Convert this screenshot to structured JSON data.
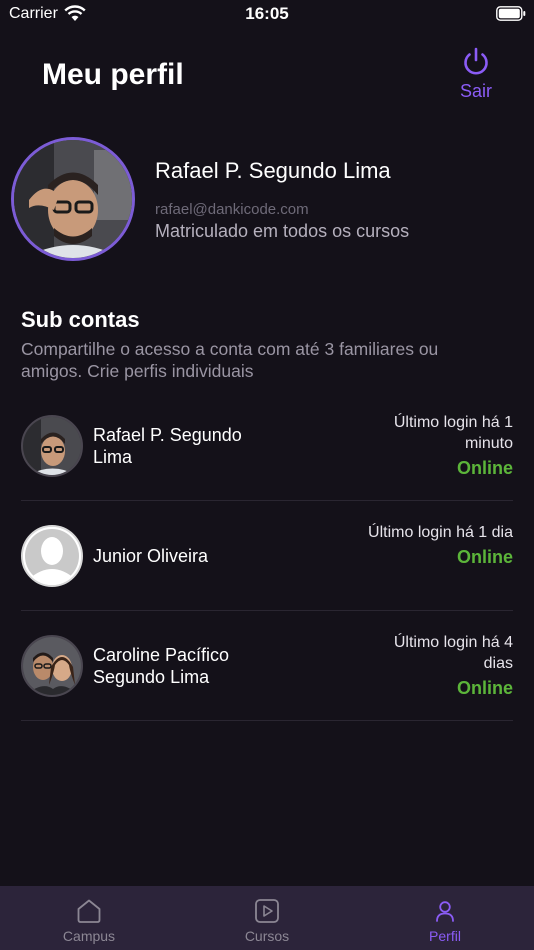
{
  "status_bar": {
    "carrier": "Carrier",
    "time": "16:05"
  },
  "header": {
    "title": "Meu perfil",
    "logout_label": "Sair",
    "logout_icon": "power-icon",
    "accent": "#8b5cf6"
  },
  "profile": {
    "name": "Rafael P. Segundo Lima",
    "email": "rafael@dankicode.com",
    "enrollment": "Matriculado em todos os cursos"
  },
  "sub_accounts": {
    "title": "Sub contas",
    "description": "Compartilhe o acesso a conta com até 3 familiares ou amigos. Crie perfis individuais",
    "items": [
      {
        "name": "Rafael P. Segundo Lima",
        "last_login": "Último login há 1 minuto",
        "status": "Online"
      },
      {
        "name": "Junior Oliveira",
        "last_login": "Último login há 1 dia",
        "status": "Online"
      },
      {
        "name": "Caroline Pacífico Segundo Lima",
        "last_login": "Último login há 4 dias",
        "status": "Online"
      }
    ],
    "online_color": "#5cb53a"
  },
  "tabbar": {
    "tabs": [
      {
        "label": "Campus",
        "icon": "home-icon"
      },
      {
        "label": "Cursos",
        "icon": "play-icon"
      },
      {
        "label": "Perfil",
        "icon": "user-icon"
      }
    ],
    "active": "Perfil"
  }
}
